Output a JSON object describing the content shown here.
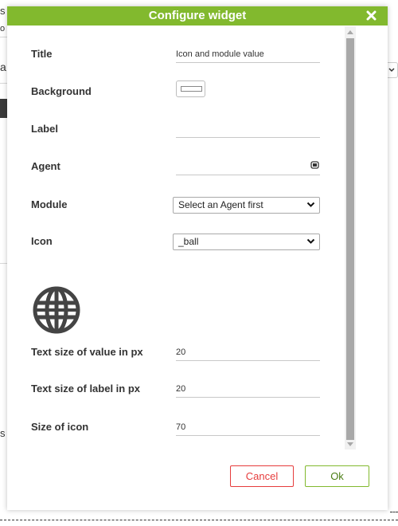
{
  "dialog": {
    "title": "Configure widget",
    "close_label": "✖"
  },
  "fields": {
    "title_label": "Title",
    "title_value": "Icon and module value",
    "background_label": "Background",
    "label_label": "Label",
    "label_value": "",
    "agent_label": "Agent",
    "agent_value": "",
    "module_label": "Module",
    "module_selected": "Select an Agent first",
    "icon_label": "Icon",
    "icon_selected": "_ball",
    "text_size_value_label": "Text size of value in px",
    "text_size_value": "20",
    "text_size_label_label": "Text size of label in px",
    "text_size_label": "20",
    "size_icon_label": "Size of icon",
    "size_icon": "70"
  },
  "buttons": {
    "cancel_label": "Cancel",
    "ok_label": "Ok"
  },
  "background_fragments": {
    "frag_top": "s",
    "frag_second": "o",
    "frag_mid": "a",
    "frag_bottom": "s"
  },
  "colors": {
    "accent": "#82b92e",
    "cancel": "#e63c3c",
    "scroll_thumb": "#a8a8a8"
  },
  "icons": {
    "close": "close-icon",
    "agent_field": "agent-search-icon",
    "preview": "globe-ball-icon"
  }
}
